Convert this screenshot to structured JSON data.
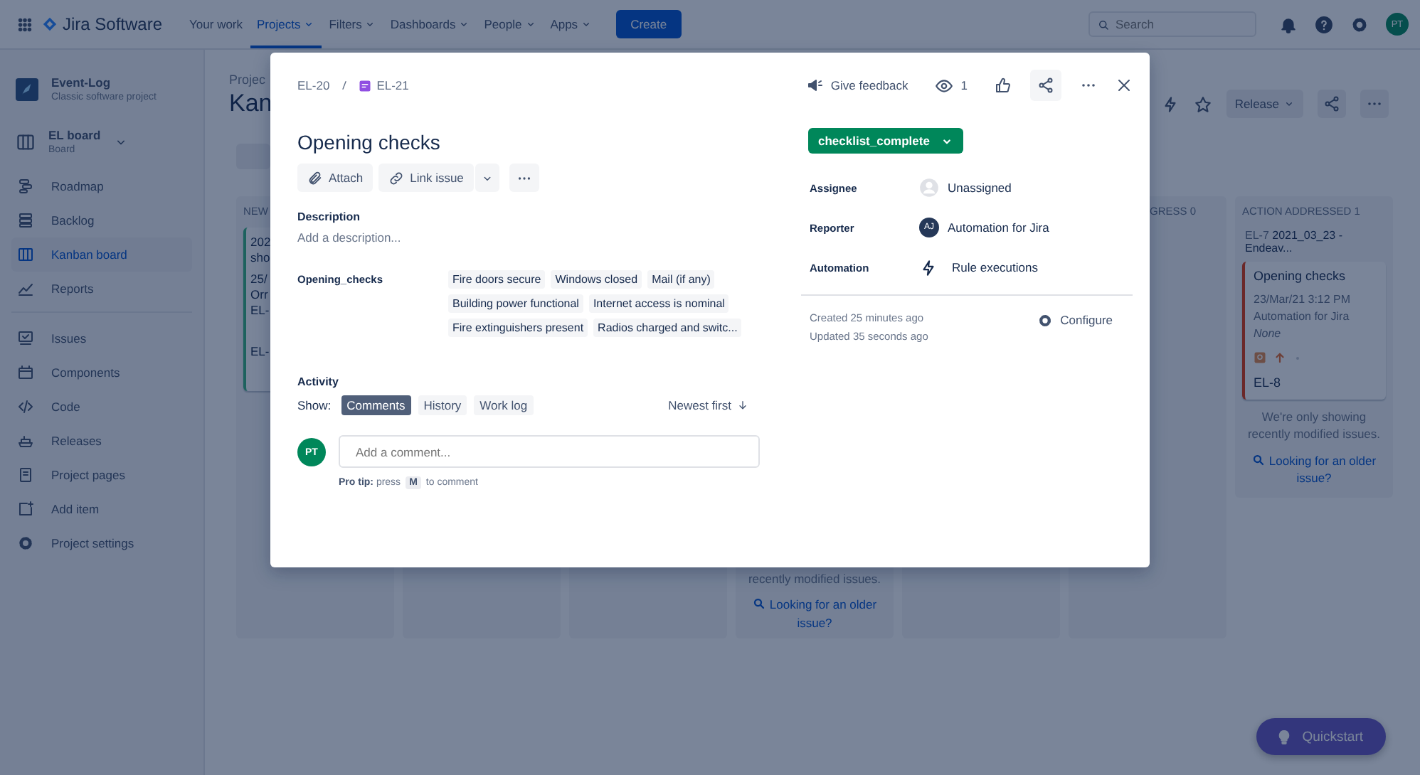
{
  "topnav": {
    "product": "Jira Software",
    "items": [
      {
        "label": "Your work",
        "dropdown": false,
        "selected": false
      },
      {
        "label": "Projects",
        "dropdown": true,
        "selected": true
      },
      {
        "label": "Filters",
        "dropdown": true,
        "selected": false
      },
      {
        "label": "Dashboards",
        "dropdown": true,
        "selected": false
      },
      {
        "label": "People",
        "dropdown": true,
        "selected": false
      },
      {
        "label": "Apps",
        "dropdown": true,
        "selected": false
      }
    ],
    "create": "Create",
    "search": {
      "placeholder": "Search"
    },
    "avatar": "PT"
  },
  "sidebar": {
    "project": {
      "name": "Event-Log",
      "type": "Classic software project"
    },
    "board": {
      "name": "EL board",
      "type": "Board"
    },
    "sections": [
      {
        "items": [
          {
            "label": "Roadmap",
            "kind": "roadmap",
            "selected": false
          },
          {
            "label": "Backlog",
            "kind": "backlog",
            "selected": false
          },
          {
            "label": "Kanban board",
            "kind": "board",
            "selected": true
          },
          {
            "label": "Reports",
            "kind": "reports",
            "selected": false
          }
        ]
      },
      {
        "items": [
          {
            "label": "Issues",
            "kind": "issues",
            "selected": false
          },
          {
            "label": "Components",
            "kind": "components",
            "selected": false
          },
          {
            "label": "Code",
            "kind": "code",
            "selected": false
          },
          {
            "label": "Releases",
            "kind": "releases",
            "selected": false
          },
          {
            "label": "Project pages",
            "kind": "pages",
            "selected": false
          },
          {
            "label": "Add item",
            "kind": "add",
            "selected": false
          },
          {
            "label": "Project settings",
            "kind": "settings",
            "selected": false
          }
        ]
      }
    ]
  },
  "board_header": {
    "breadcrumb": "Projec",
    "title": "Kan",
    "release": "Release"
  },
  "board": {
    "columns": [
      {
        "header": "NEW",
        "card_lines": [
          "202",
          "sho",
          "25/",
          "Orr",
          "EL-",
          "EL-"
        ]
      },
      {},
      {},
      {
        "notice": "recently modified issues.",
        "link": "Looking for an older issue?"
      },
      {},
      {
        "header": "GRESS 0"
      },
      {
        "header": "ACTION ADDRESSED 1",
        "parent_key": "EL-7",
        "parent_title": "2021_03_23 - Endeav...",
        "card": {
          "title": "Opening checks",
          "date": "23/Mar/21 3:12 PM",
          "reporter": "Automation for Jira",
          "assignee": "None",
          "key": "EL-8"
        },
        "notice": "We're only showing recently modified issues.",
        "link": "Looking for an older issue?"
      }
    ]
  },
  "issue": {
    "parent": "EL-20",
    "key": "EL-21",
    "feedback": "Give feedback",
    "watchers": "1",
    "title": "Opening checks",
    "actions": [
      "Attach",
      "Link issue"
    ],
    "description": {
      "label": "Description",
      "placeholder": "Add a description..."
    },
    "checklist": {
      "label": "Opening_checks",
      "items": [
        "Fire doors secure",
        "Windows closed",
        "Mail (if any)",
        "Building power functional",
        "Internet access is nominal",
        "Fire extinguishers present",
        "Radios charged and switc..."
      ]
    },
    "activity": {
      "label": "Activity",
      "show": "Show:",
      "filters": [
        {
          "label": "Comments",
          "selected": true
        },
        {
          "label": "History",
          "selected": false
        },
        {
          "label": "Work log",
          "selected": false
        }
      ],
      "sort": "Newest first",
      "avatar": "PT",
      "comment_placeholder": "Add a comment...",
      "tip": "**Pro tip:** press",
      "tip_key": "M",
      "tip_end": "to comment"
    },
    "status": "checklist_complete",
    "fields": [
      {
        "label": "Assignee",
        "value": "Unassigned",
        "kind": "empty-avatar"
      },
      {
        "label": "Reporter",
        "value": "Automation for Jira",
        "kind": "initials",
        "initials": "AJ"
      },
      {
        "label": "Automation",
        "value": "Rule executions",
        "kind": "bolt"
      }
    ],
    "created": "Created 25 minutes ago",
    "updated": "Updated 35 seconds ago",
    "configure": "Configure"
  },
  "quickstart": "Quickstart"
}
